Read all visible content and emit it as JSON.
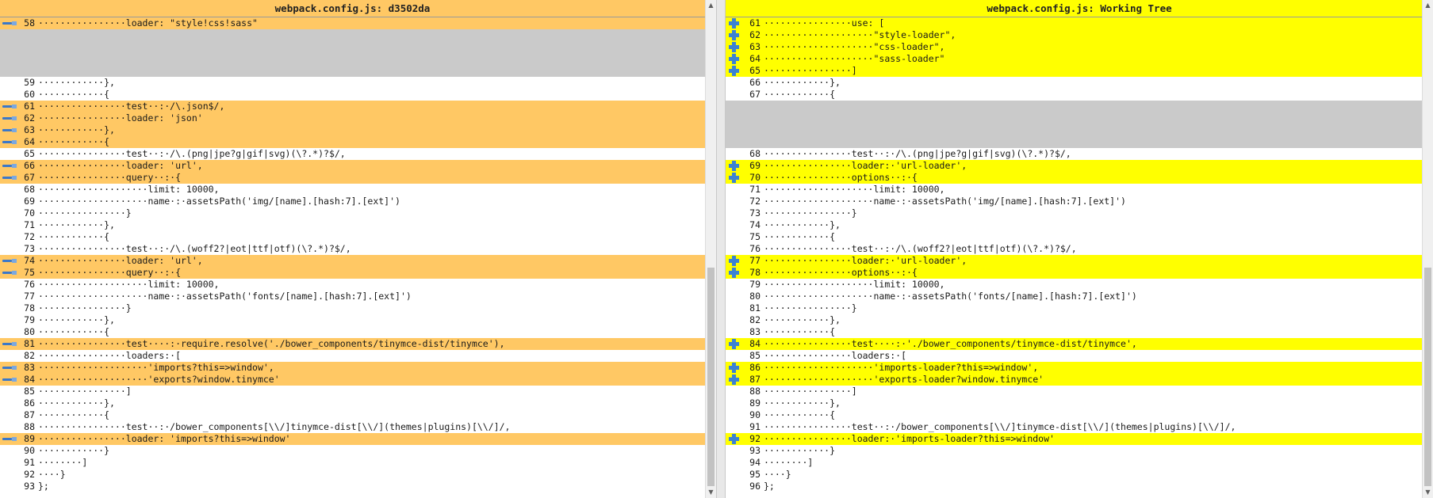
{
  "left": {
    "title": "webpack.config.js: d3502da",
    "rows": [
      {
        "n": "58",
        "k": "del",
        "t": "················loader: \"style!css!sass\""
      },
      {
        "n": "",
        "k": "gap",
        "t": ""
      },
      {
        "n": "",
        "k": "gap",
        "t": ""
      },
      {
        "n": "",
        "k": "gap",
        "t": ""
      },
      {
        "n": "",
        "k": "gap",
        "t": ""
      },
      {
        "n": "59",
        "k": "",
        "t": "············},"
      },
      {
        "n": "60",
        "k": "",
        "t": "············{"
      },
      {
        "n": "61",
        "k": "del",
        "t": "················test··:·/\\.json$/,"
      },
      {
        "n": "62",
        "k": "del",
        "t": "················loader: 'json'"
      },
      {
        "n": "63",
        "k": "del",
        "t": "············},"
      },
      {
        "n": "64",
        "k": "del",
        "t": "············{"
      },
      {
        "n": "65",
        "k": "",
        "t": "················test··:·/\\.(png|jpe?g|gif|svg)(\\?.*)?$/,"
      },
      {
        "n": "66",
        "k": "del",
        "t": "················loader: 'url',"
      },
      {
        "n": "67",
        "k": "del",
        "t": "················query··:·{"
      },
      {
        "n": "68",
        "k": "",
        "t": "····················limit: 10000,"
      },
      {
        "n": "69",
        "k": "",
        "t": "····················name·:·assetsPath('img/[name].[hash:7].[ext]')"
      },
      {
        "n": "70",
        "k": "",
        "t": "················}"
      },
      {
        "n": "71",
        "k": "",
        "t": "············},"
      },
      {
        "n": "72",
        "k": "",
        "t": "············{"
      },
      {
        "n": "73",
        "k": "",
        "t": "················test··:·/\\.(woff2?|eot|ttf|otf)(\\?.*)?$/,"
      },
      {
        "n": "74",
        "k": "del",
        "t": "················loader: 'url',"
      },
      {
        "n": "75",
        "k": "del",
        "t": "················query··:·{"
      },
      {
        "n": "76",
        "k": "",
        "t": "····················limit: 10000,"
      },
      {
        "n": "77",
        "k": "",
        "t": "····················name·:·assetsPath('fonts/[name].[hash:7].[ext]')"
      },
      {
        "n": "78",
        "k": "",
        "t": "················}"
      },
      {
        "n": "79",
        "k": "",
        "t": "············},"
      },
      {
        "n": "80",
        "k": "",
        "t": "············{"
      },
      {
        "n": "81",
        "k": "del",
        "t": "················test····:·require.resolve('./bower_components/tinymce-dist/tinymce'),"
      },
      {
        "n": "82",
        "k": "",
        "t": "················loaders:·["
      },
      {
        "n": "83",
        "k": "del",
        "t": "····················'imports?this=>window',"
      },
      {
        "n": "84",
        "k": "del",
        "t": "····················'exports?window.tinymce'"
      },
      {
        "n": "85",
        "k": "",
        "t": "················]"
      },
      {
        "n": "86",
        "k": "",
        "t": "············},"
      },
      {
        "n": "87",
        "k": "",
        "t": "············{"
      },
      {
        "n": "88",
        "k": "",
        "t": "················test··:·/bower_components[\\\\/]tinymce-dist[\\\\/](themes|plugins)[\\\\/]/,"
      },
      {
        "n": "89",
        "k": "del",
        "t": "················loader: 'imports?this=>window'"
      },
      {
        "n": "90",
        "k": "",
        "t": "············}"
      },
      {
        "n": "91",
        "k": "",
        "t": "········]"
      },
      {
        "n": "92",
        "k": "",
        "t": "····}"
      },
      {
        "n": "93",
        "k": "",
        "t": "};"
      }
    ]
  },
  "right": {
    "title": "webpack.config.js: Working Tree",
    "rows": [
      {
        "n": "61",
        "k": "add",
        "t": "················use: ["
      },
      {
        "n": "62",
        "k": "add",
        "t": "····················\"style-loader\","
      },
      {
        "n": "63",
        "k": "add",
        "t": "····················\"css-loader\","
      },
      {
        "n": "64",
        "k": "add",
        "t": "····················\"sass-loader\""
      },
      {
        "n": "65",
        "k": "add",
        "t": "················]"
      },
      {
        "n": "66",
        "k": "",
        "t": "············},"
      },
      {
        "n": "67",
        "k": "",
        "t": "············{"
      },
      {
        "n": "",
        "k": "gap",
        "t": ""
      },
      {
        "n": "",
        "k": "gap",
        "t": ""
      },
      {
        "n": "",
        "k": "gap",
        "t": ""
      },
      {
        "n": "",
        "k": "gap",
        "t": ""
      },
      {
        "n": "68",
        "k": "",
        "t": "················test··:·/\\.(png|jpe?g|gif|svg)(\\?.*)?$/,"
      },
      {
        "n": "69",
        "k": "add",
        "t": "················loader:·'url-loader',"
      },
      {
        "n": "70",
        "k": "add",
        "t": "················options··:·{"
      },
      {
        "n": "71",
        "k": "",
        "t": "····················limit: 10000,"
      },
      {
        "n": "72",
        "k": "",
        "t": "····················name·:·assetsPath('img/[name].[hash:7].[ext]')"
      },
      {
        "n": "73",
        "k": "",
        "t": "················}"
      },
      {
        "n": "74",
        "k": "",
        "t": "············},"
      },
      {
        "n": "75",
        "k": "",
        "t": "············{"
      },
      {
        "n": "76",
        "k": "",
        "t": "················test··:·/\\.(woff2?|eot|ttf|otf)(\\?.*)?$/,"
      },
      {
        "n": "77",
        "k": "add",
        "t": "················loader:·'url-loader',"
      },
      {
        "n": "78",
        "k": "add",
        "t": "················options··:·{"
      },
      {
        "n": "79",
        "k": "",
        "t": "····················limit: 10000,"
      },
      {
        "n": "80",
        "k": "",
        "t": "····················name·:·assetsPath('fonts/[name].[hash:7].[ext]')"
      },
      {
        "n": "81",
        "k": "",
        "t": "················}"
      },
      {
        "n": "82",
        "k": "",
        "t": "············},"
      },
      {
        "n": "83",
        "k": "",
        "t": "············{"
      },
      {
        "n": "84",
        "k": "add",
        "t": "················test····:·'./bower_components/tinymce-dist/tinymce',"
      },
      {
        "n": "85",
        "k": "",
        "t": "················loaders:·["
      },
      {
        "n": "86",
        "k": "add",
        "t": "····················'imports-loader?this=>window',"
      },
      {
        "n": "87",
        "k": "add",
        "t": "····················'exports-loader?window.tinymce'"
      },
      {
        "n": "88",
        "k": "",
        "t": "················]"
      },
      {
        "n": "89",
        "k": "",
        "t": "············},"
      },
      {
        "n": "90",
        "k": "",
        "t": "············{"
      },
      {
        "n": "91",
        "k": "",
        "t": "················test··:·/bower_components[\\\\/]tinymce-dist[\\\\/](themes|plugins)[\\\\/]/,"
      },
      {
        "n": "92",
        "k": "add",
        "t": "················loader:·'imports-loader?this=>window'"
      },
      {
        "n": "93",
        "k": "",
        "t": "············}"
      },
      {
        "n": "94",
        "k": "",
        "t": "········]"
      },
      {
        "n": "95",
        "k": "",
        "t": "····}"
      },
      {
        "n": "96",
        "k": "",
        "t": "};"
      }
    ]
  },
  "colors": {
    "deleted_line": "#ffc864",
    "added_line": "#ffff00",
    "gap_fill": "#cacaca",
    "changed_word_left": "#c86450",
    "marker_icon": "#3c82d2"
  },
  "icons": {
    "removed_marker": "minus-arrow-icon",
    "added_marker": "plus-icon"
  }
}
